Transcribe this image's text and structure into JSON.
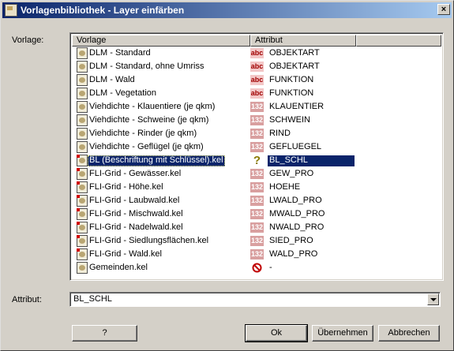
{
  "window": {
    "title": "Vorlagenbibliothek - Layer einfärben",
    "close_label": "×"
  },
  "labels": {
    "vorlage": "Vorlage:",
    "attribut": "Attribut:"
  },
  "columns": [
    "Vorlage",
    "Attribut"
  ],
  "rows": [
    {
      "name": "DLM - Standard",
      "attr": "OBJEKTART",
      "type": "abc",
      "type_label": "abc",
      "red_marker": false,
      "selected": false
    },
    {
      "name": "DLM - Standard, ohne Umriss",
      "attr": "OBJEKTART",
      "type": "abc",
      "type_label": "abc",
      "red_marker": false,
      "selected": false
    },
    {
      "name": "DLM - Wald",
      "attr": "FUNKTION",
      "type": "abc",
      "type_label": "abc",
      "red_marker": false,
      "selected": false
    },
    {
      "name": "DLM - Vegetation",
      "attr": "FUNKTION",
      "type": "abc",
      "type_label": "abc",
      "red_marker": false,
      "selected": false
    },
    {
      "name": "Viehdichte - Klauentiere (je qkm)",
      "attr": "KLAUENTIER",
      "type": "num",
      "type_label": "132",
      "red_marker": false,
      "selected": false
    },
    {
      "name": "Viehdichte - Schweine (je qkm)",
      "attr": "SCHWEIN",
      "type": "num",
      "type_label": "132",
      "red_marker": false,
      "selected": false
    },
    {
      "name": "Viehdichte - Rinder (je qkm)",
      "attr": "RIND",
      "type": "num",
      "type_label": "132",
      "red_marker": false,
      "selected": false
    },
    {
      "name": "Viehdichte - Geflügel (je qkm)",
      "attr": "GEFLUEGEL",
      "type": "num",
      "type_label": "132",
      "red_marker": false,
      "selected": false
    },
    {
      "name": "BL (Beschriftung mit Schlüssel).kel",
      "attr": "BL_SCHL",
      "type": "q",
      "type_label": "?",
      "red_marker": true,
      "selected": true
    },
    {
      "name": "FLI-Grid - Gewässer.kel",
      "attr": "GEW_PRO",
      "type": "num",
      "type_label": "132",
      "red_marker": true,
      "selected": false
    },
    {
      "name": "FLI-Grid - Höhe.kel",
      "attr": "HOEHE",
      "type": "num",
      "type_label": "132",
      "red_marker": true,
      "selected": false
    },
    {
      "name": "FLI-Grid - Laubwald.kel",
      "attr": "LWALD_PRO",
      "type": "num",
      "type_label": "132",
      "red_marker": true,
      "selected": false
    },
    {
      "name": "FLI-Grid - Mischwald.kel",
      "attr": "MWALD_PRO",
      "type": "num",
      "type_label": "132",
      "red_marker": true,
      "selected": false
    },
    {
      "name": "FLI-Grid - Nadelwald.kel",
      "attr": "NWALD_PRO",
      "type": "num",
      "type_label": "132",
      "red_marker": true,
      "selected": false
    },
    {
      "name": "FLI-Grid - Siedlungsflächen.kel",
      "attr": "SIED_PRO",
      "type": "num",
      "type_label": "132",
      "red_marker": true,
      "selected": false
    },
    {
      "name": "FLI-Grid - Wald.kel",
      "attr": "WALD_PRO",
      "type": "num",
      "type_label": "132",
      "red_marker": true,
      "selected": false
    },
    {
      "name": "Gemeinden.kel",
      "attr": "-",
      "type": "none",
      "type_label": "",
      "red_marker": false,
      "selected": false
    }
  ],
  "attribut_select": {
    "value": "BL_SCHL"
  },
  "buttons": {
    "help": "?",
    "ok": "Ok",
    "apply": "Übernehmen",
    "cancel": "Abbrechen"
  },
  "colors": {
    "title_start": "#0a246a",
    "title_end": "#a6caf0",
    "selection": "#0a246a",
    "face": "#d4d0c8"
  }
}
